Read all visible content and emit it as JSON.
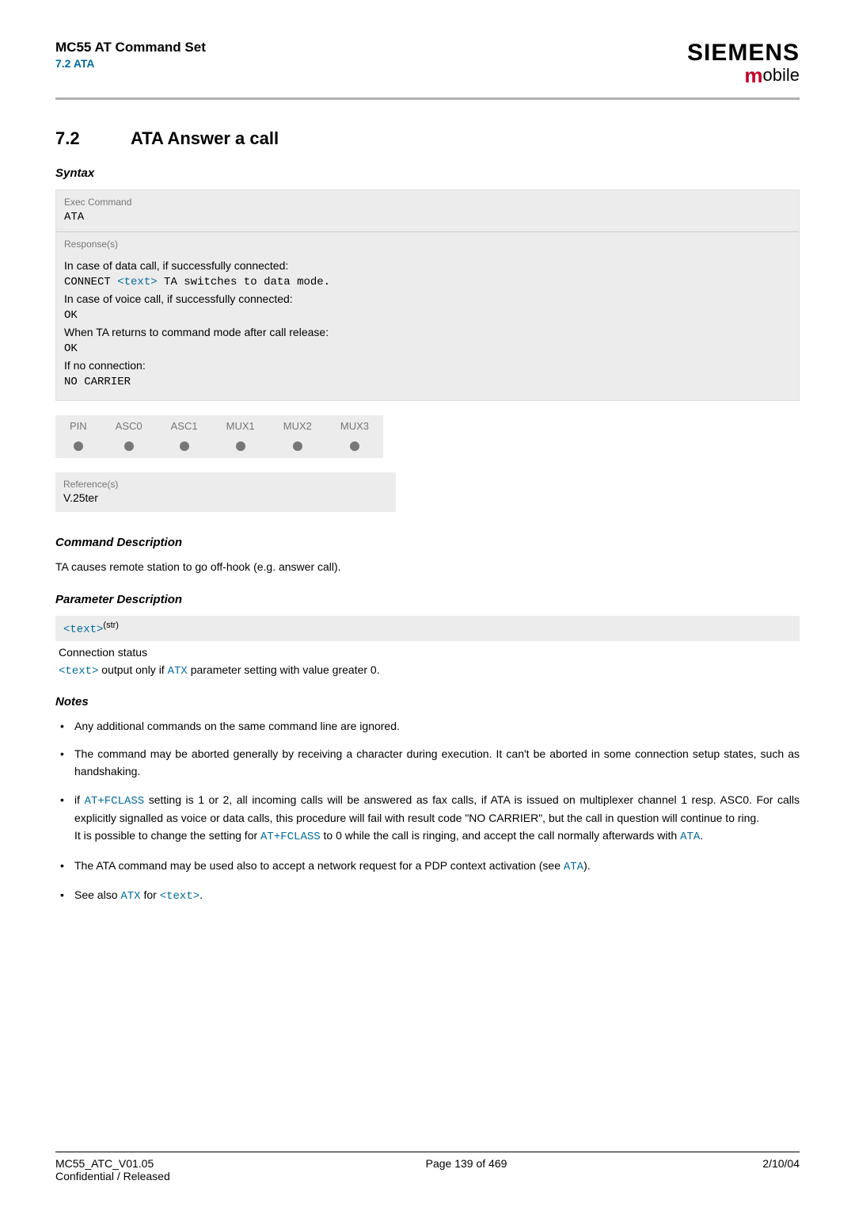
{
  "header": {
    "doc_title": "MC55 AT Command Set",
    "section_ref": "7.2 ATA",
    "brand": "SIEMENS",
    "subbrand_rest": "obile"
  },
  "section": {
    "number": "7.2",
    "title": "ATA   Answer a call"
  },
  "syntax": {
    "heading": "Syntax",
    "exec_label": "Exec Command",
    "exec_code": "ATA",
    "response_label": "Response(s)",
    "line1": "In case of data call, if successfully connected:",
    "line2_pre": "CONNECT ",
    "line2_tag": "<text>",
    "line2_post": " TA switches to data mode.",
    "line3": "In case of voice call, if successfully connected:",
    "line4": "OK",
    "line5": "When TA returns to command mode after call release:",
    "line6": "OK",
    "line7": "If no connection:",
    "line8": "NO CARRIER"
  },
  "compat": {
    "cols": [
      "PIN",
      "ASC0",
      "ASC1",
      "MUX1",
      "MUX2",
      "MUX3"
    ]
  },
  "reference": {
    "label": "Reference(s)",
    "value": "V.25ter"
  },
  "cmd_desc": {
    "heading": "Command Description",
    "text": "TA causes remote station to go off-hook (e.g. answer call)."
  },
  "param_desc": {
    "heading": "Parameter Description",
    "param_tag": "<text>",
    "param_sup": "(str)",
    "param_title": "Connection status",
    "detail_tag": "<text>",
    "detail_mid": " output only if ",
    "detail_link": "ATX",
    "detail_post": " parameter setting with value greater 0."
  },
  "notes": {
    "heading": "Notes",
    "n1": "Any additional commands on the same command line are ignored.",
    "n2": "The command may be aborted generally by receiving a character during execution. It can't be aborted in some connection setup states, such as handshaking.",
    "n3_pre": "if ",
    "n3_l1": "AT+FCLASS",
    "n3_mid1": " setting is 1 or 2, all incoming calls will be answered as fax calls, if ATA is issued on multiplexer channel 1 resp. ASC0. For calls explicitly signalled as voice or data calls, this procedure will fail with result code \"NO CARRIER\", but the call in question will continue to ring.",
    "n3_line2_pre": "It is possible to change the setting for ",
    "n3_l2": "AT+FCLASS",
    "n3_line2_mid": " to 0 while the call is ringing, and accept the call normally afterwards with ",
    "n3_l3": "ATA",
    "n3_line2_post": ".",
    "n4_pre": "The ATA command may be used also to accept a network request for a PDP context activation (see ",
    "n4_link": "ATA",
    "n4_post": ").",
    "n5_pre": "See also ",
    "n5_l1": "ATX",
    "n5_mid": " for ",
    "n5_l2": "<text>",
    "n5_post": "."
  },
  "footer": {
    "left1": "MC55_ATC_V01.05",
    "left2": "Confidential / Released",
    "center": "Page 139 of 469",
    "right": "2/10/04"
  }
}
